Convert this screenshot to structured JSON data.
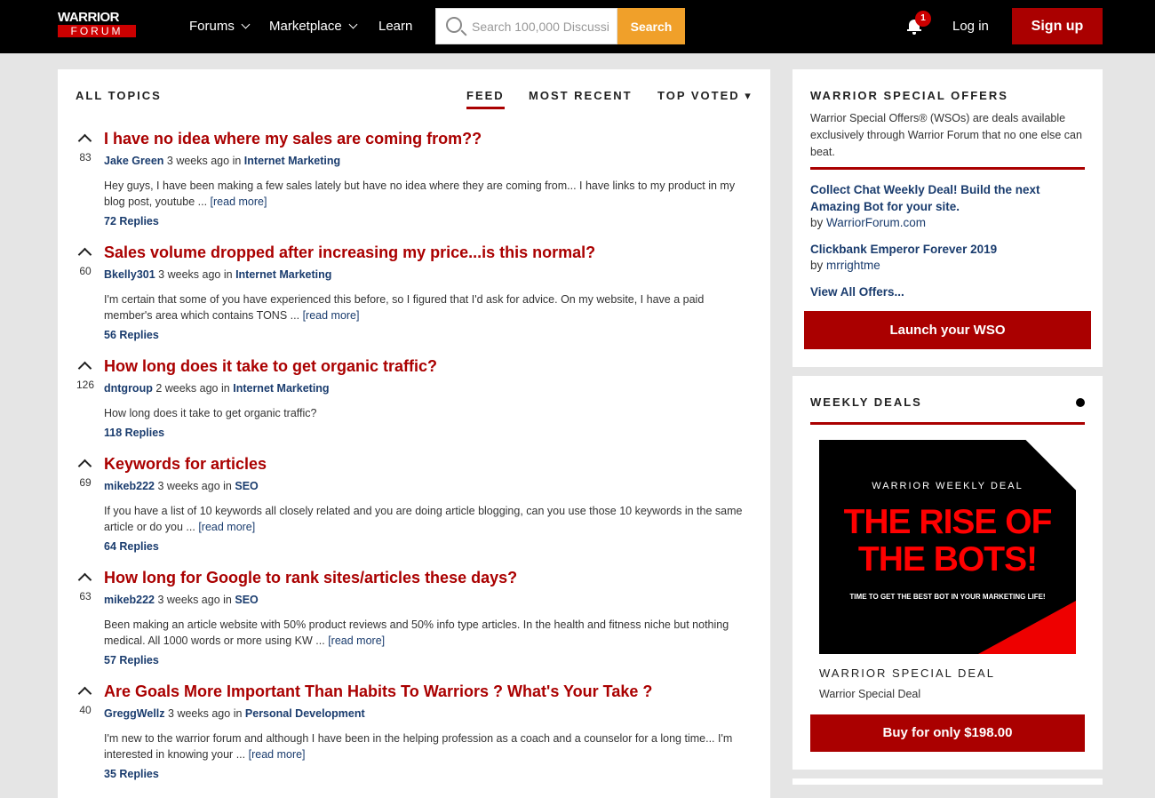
{
  "header": {
    "logo_top": "WARRIOR",
    "logo_bottom": "FORUM",
    "nav": [
      "Forums",
      "Marketplace",
      "Learn"
    ],
    "search_placeholder": "Search 100,000 Discussi",
    "search_button": "Search",
    "notification_count": "1",
    "login": "Log in",
    "signup": "Sign up"
  },
  "main": {
    "section_title": "ALL TOPICS",
    "tabs": [
      "FEED",
      "MOST RECENT",
      "TOP VOTED ▾"
    ],
    "active_tab": "FEED",
    "posts": [
      {
        "votes": "83",
        "title": "I have no idea where my sales are coming from??",
        "author": "Jake Green",
        "time": "3 weeks ago",
        "in": "in",
        "category": "Internet Marketing",
        "excerpt": "Hey guys, I have been making a few sales lately but have no idea where they are coming from... I have links to my product in my blog post, youtube ...",
        "read_more": "[read more]",
        "replies": "72 Replies"
      },
      {
        "votes": "60",
        "title": "Sales volume dropped after increasing my price...is this normal?",
        "author": "Bkelly301",
        "time": "3 weeks ago",
        "in": "in",
        "category": "Internet Marketing",
        "excerpt": "I'm certain that some of you have experienced this before, so I figured that I'd ask for advice. On my website, I have a paid member's area which contains TONS ...",
        "read_more": "[read more]",
        "replies": "56 Replies"
      },
      {
        "votes": "126",
        "title": "How long does it take to get organic traffic?",
        "author": "dntgroup",
        "time": "2 weeks ago",
        "in": "in",
        "category": "Internet Marketing",
        "excerpt": "How long does it take to get organic traffic?",
        "read_more": "",
        "replies": "118 Replies"
      },
      {
        "votes": "69",
        "title": "Keywords for articles",
        "author": "mikeb222",
        "time": "3 weeks ago",
        "in": "in",
        "category": "SEO",
        "excerpt": "If you have a list of 10 keywords all closely related and you are doing article blogging, can you use those 10 keywords in the same article or do you ...",
        "read_more": "[read more]",
        "replies": "64 Replies"
      },
      {
        "votes": "63",
        "title": "How long for Google to rank sites/articles these days?",
        "author": "mikeb222",
        "time": "3 weeks ago",
        "in": "in",
        "category": "SEO",
        "excerpt": "Been making an article website with 50% product reviews and 50% info type articles. In the health and fitness niche but nothing medical. All 1000 words or more using KW ...",
        "read_more": "[read more]",
        "replies": "57 Replies"
      },
      {
        "votes": "40",
        "title": "Are Goals More Important Than Habits To Warriors ? What's Your Take ?",
        "author": "GreggWellz",
        "time": "3 weeks ago",
        "in": "in",
        "category": "Personal Development",
        "excerpt": "I'm new to the warrior forum and although I have been in the helping profession as a coach and a counselor for a long time... I'm interested in knowing your ...",
        "read_more": "[read more]",
        "replies": "35 Replies"
      }
    ]
  },
  "sidebar": {
    "wso": {
      "title": "WARRIOR SPECIAL OFFERS",
      "description": "Warrior Special Offers® (WSOs) are deals available exclusively through Warrior Forum that no one else can beat.",
      "offers": [
        {
          "title": "Collect Chat Weekly Deal! Build the next Amazing Bot for your site.",
          "by": "by",
          "seller": "WarriorForum.com"
        },
        {
          "title": "Clickbank Emperor Forever 2019",
          "by": "by",
          "seller": "mrrightme"
        }
      ],
      "view_all": "View All Offers...",
      "launch_button": "Launch your WSO"
    },
    "weekly": {
      "title": "WEEKLY DEALS",
      "image_kicker": "WARRIOR WEEKLY DEAL",
      "image_headline": "THE RISE OF THE BOTS!",
      "image_sub": "TIME TO GET THE BEST BOT IN YOUR MARKETING LIFE!",
      "deal_label": "WARRIOR SPECIAL DEAL",
      "deal_name": "Warrior Special Deal",
      "buy_button": "Buy for only $198.00"
    }
  },
  "colors": {
    "brand_red": "#aa0000",
    "accent_orange": "#f0a02a",
    "link_blue": "#1a3c6e",
    "header_bg": "#000000"
  }
}
